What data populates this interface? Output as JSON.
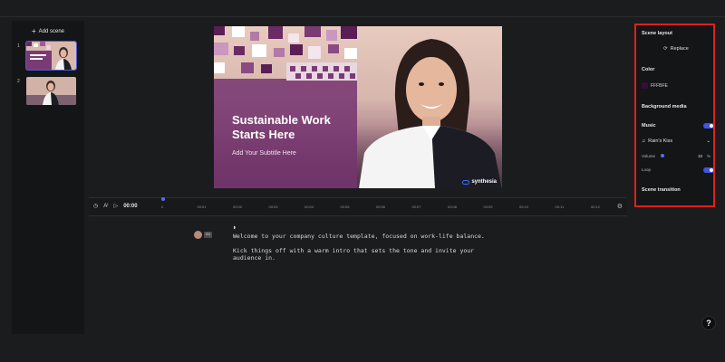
{
  "scene_panel": {
    "add_scene_label": "Add scene",
    "scenes": [
      {
        "number": "1",
        "active": true
      },
      {
        "number": "2",
        "active": false
      }
    ]
  },
  "slide": {
    "title": "Sustainable Work Starts Here",
    "subtitle": "Add Your Subtitle Here",
    "brand": "synthesia"
  },
  "properties": {
    "scene_layout": "Scene layout",
    "replace": "Replace",
    "color_heading": "Color",
    "color_value": "FFFBFE",
    "color_swatch": "#3a0a3a",
    "background_media": "Background media",
    "music": "Music",
    "music_track": "Rain's Kiss",
    "volume_label": "Volume",
    "volume_value": "10",
    "volume_unit": "%",
    "loop_label": "Loop",
    "scene_transition": "Scene transition",
    "music_enabled": true,
    "loop_enabled": true
  },
  "timeline": {
    "current_time": "00:00",
    "ticks": [
      "0",
      "00:01",
      "00:02",
      "00:03",
      "00:04",
      "00:05",
      "00:06",
      "00:07",
      "00:08",
      "00:09",
      "00:10",
      "00:11",
      "00:12"
    ]
  },
  "script": {
    "lines": [
      "Welcome to your company culture template, focused on work-life balance.",
      "Kick things off with a warm intro that sets the tone and invite your audience in."
    ],
    "language": "EN"
  },
  "help_label": "?",
  "accent_color": "#3f55e0",
  "highlight_color": "#e0201d"
}
